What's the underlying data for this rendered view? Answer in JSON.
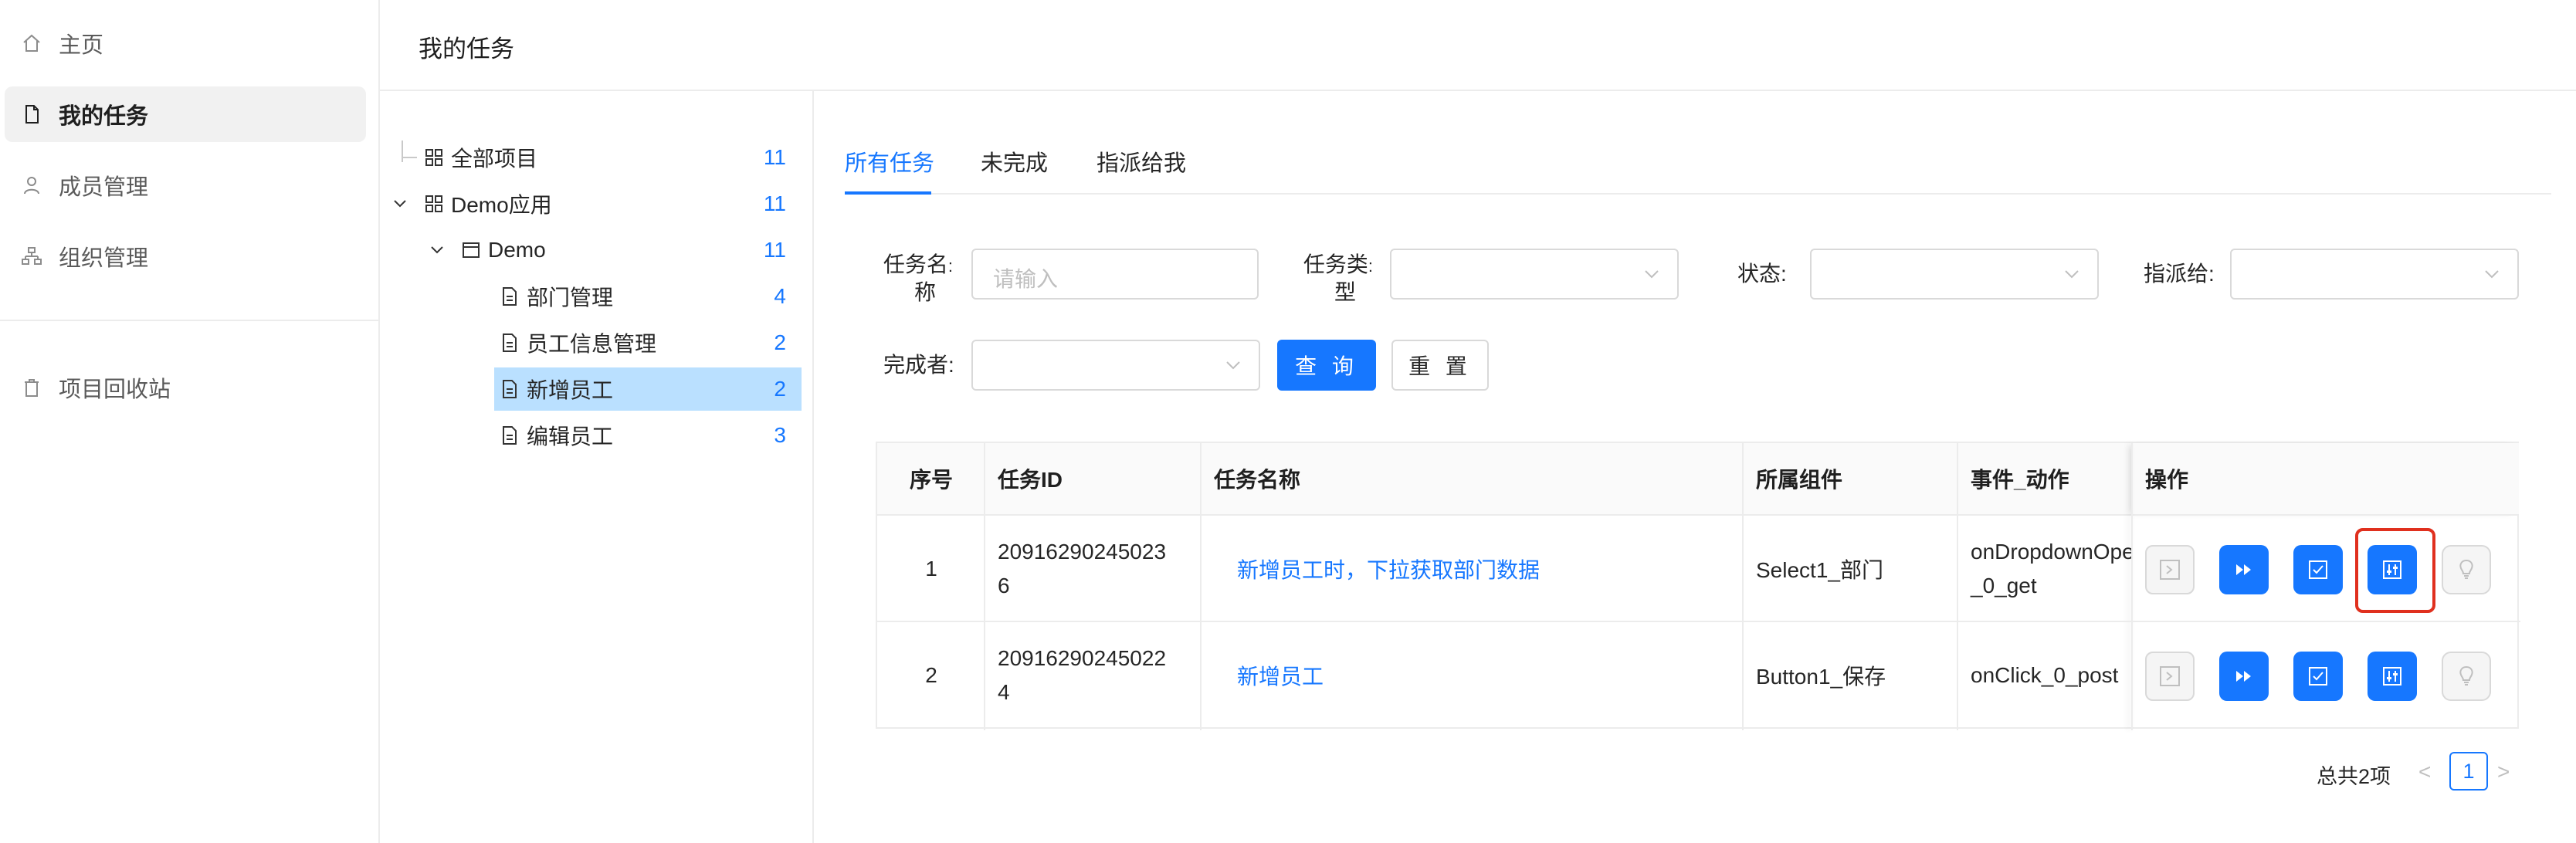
{
  "sidebar": {
    "items": [
      {
        "label": "主页",
        "icon": "home-icon"
      },
      {
        "label": "我的任务",
        "icon": "file-icon"
      },
      {
        "label": "成员管理",
        "icon": "user-icon"
      },
      {
        "label": "组织管理",
        "icon": "org-icon"
      },
      {
        "label": "项目回收站",
        "icon": "trash-icon"
      }
    ]
  },
  "header": {
    "title": "我的任务"
  },
  "tree": {
    "nodes": [
      {
        "label": "全部项目",
        "count": "11"
      },
      {
        "label": "Demo应用",
        "count": "11"
      },
      {
        "label": "Demo",
        "count": "11"
      },
      {
        "label": "部门管理",
        "count": "4"
      },
      {
        "label": "员工信息管理",
        "count": "2"
      },
      {
        "label": "新增员工",
        "count": "2"
      },
      {
        "label": "编辑员工",
        "count": "3"
      }
    ]
  },
  "tabs": [
    "所有任务",
    "未完成",
    "指派给我"
  ],
  "filters": {
    "task_name_label_1": "任务名",
    "task_name_label_2": "称",
    "task_name_placeholder": "请输入",
    "task_type_label_1": "任务类",
    "task_type_label_2": "型",
    "status_label": "状态",
    "assignee_label": "指派给",
    "completer_label": "完成者",
    "colon": ":",
    "search_button": "查 询",
    "reset_button": "重 置"
  },
  "table": {
    "headers": [
      "序号",
      "任务ID",
      "任务名称",
      "所属组件",
      "事件_动作",
      "操作"
    ],
    "rows": [
      {
        "index": "1",
        "id_line1": "20916290245023",
        "id_line2": "6",
        "name": "新增员工时，下拉获取部门数据",
        "component": "Select1_部门",
        "event_line1": "onDropdownOpe",
        "event_line2": "_0_get"
      },
      {
        "index": "2",
        "id_line1": "20916290245022",
        "id_line2": "4",
        "name": "新增员工",
        "component": "Button1_保存",
        "event_line1": "onClick_0_post",
        "event_line2": ""
      }
    ]
  },
  "pagination": {
    "total": "总共2项",
    "prev": "<",
    "page": "1",
    "next": ">"
  },
  "colors": {
    "accent": "#1677ff",
    "selected_bg": "#bae0ff",
    "highlight": "#e0301e"
  }
}
